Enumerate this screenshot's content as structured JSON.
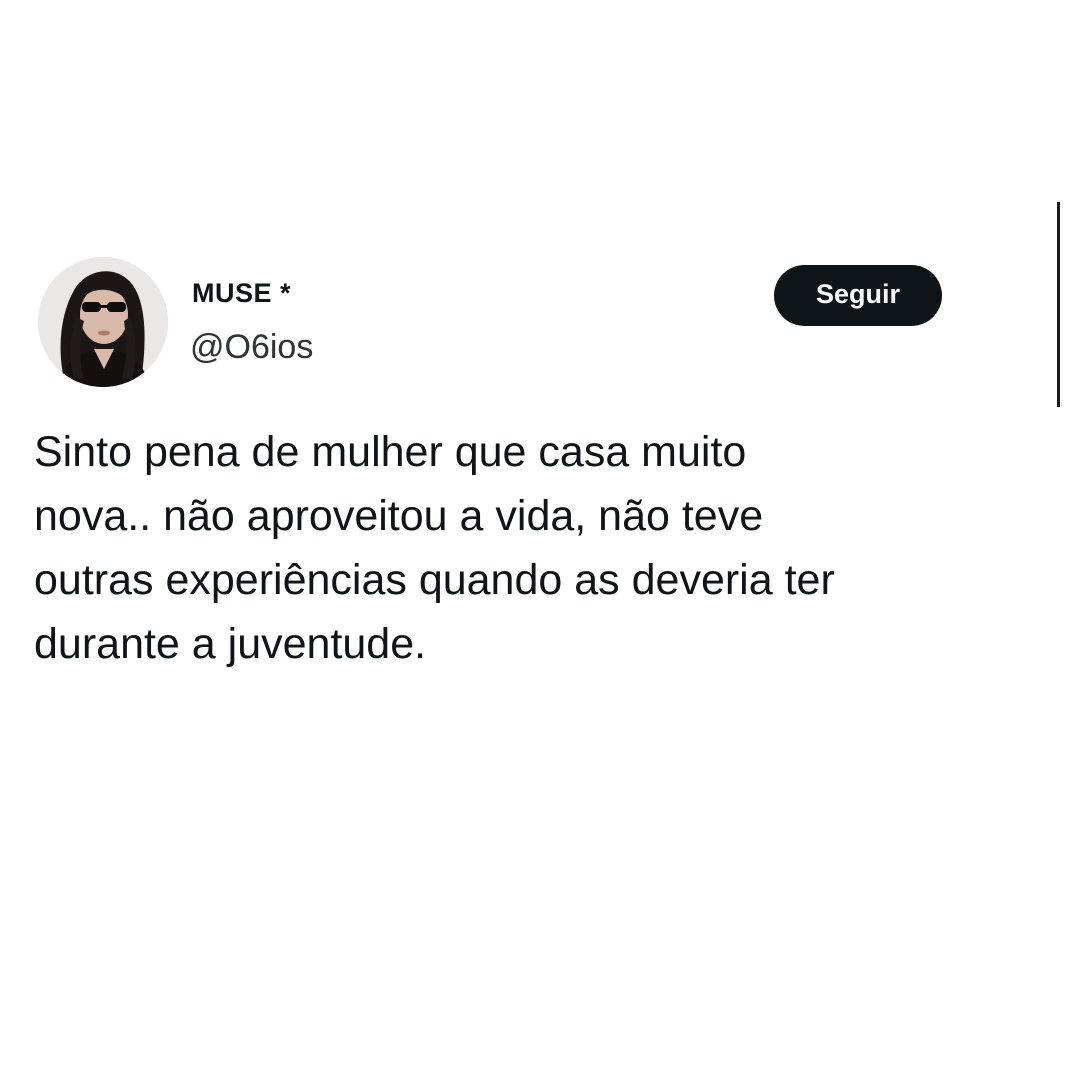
{
  "tweet": {
    "author": {
      "display_name": "MUSE *",
      "handle": "@O6ios",
      "avatar": "profile-photo"
    },
    "follow_label": "Seguir",
    "text": "Sinto pena de mulher que casa muito\nnova.. não aproveitou a vida, não teve\noutras experiências quando as deveria ter\ndurante a juventude."
  },
  "colors": {
    "text": "#0f1419",
    "handle": "#2f3336",
    "button_bg": "#0f1419",
    "button_text": "#ffffff",
    "background": "#ffffff"
  }
}
